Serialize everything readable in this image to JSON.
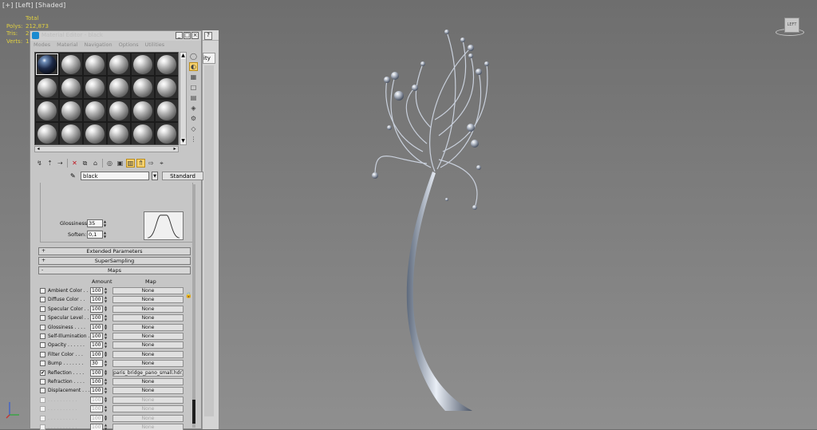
{
  "viewport": {
    "label": "[+] [Left] [Shaded]",
    "stats": [
      {
        "key": "",
        "value": "Total"
      },
      {
        "key": "Polys:",
        "value": "212,873"
      },
      {
        "key": "Tris:",
        "value": "2"
      },
      {
        "key": "Verts:",
        "value": "1"
      }
    ],
    "viewcube_label": "LEFT"
  },
  "back_window": {
    "tab_label": "ity",
    "button": "?"
  },
  "material_editor": {
    "title": "Material Editor - black",
    "window_buttons": {
      "minimize": "_",
      "maximize": "□",
      "close": "×"
    },
    "menu": [
      "Modes",
      "Material",
      "Navigation",
      "Options",
      "Utilities"
    ],
    "material_name": "black",
    "material_type": "Standard",
    "shader": {
      "glossiness_label": "Glossiness:",
      "glossiness": "35",
      "soften_label": "Soften:",
      "soften": "0,1"
    },
    "rollouts": {
      "extended": {
        "sign": "+",
        "label": "Extended Parameters"
      },
      "supersampling": {
        "sign": "+",
        "label": "SuperSampling"
      },
      "maps": {
        "sign": "-",
        "label": "Maps"
      }
    },
    "maps_header": {
      "amount": "Amount",
      "map": "Map"
    },
    "maps": [
      {
        "label": "Ambient Color . .",
        "amount": "100",
        "map": "None",
        "checked": false,
        "enabled": true
      },
      {
        "label": "Diffuse Color . .",
        "amount": "100",
        "map": "None",
        "checked": false,
        "enabled": true
      },
      {
        "label": "Specular Color . .",
        "amount": "100",
        "map": "None",
        "checked": false,
        "enabled": true
      },
      {
        "label": "Specular Level . .",
        "amount": "100",
        "map": "None",
        "checked": false,
        "enabled": true
      },
      {
        "label": "Glossiness . . . .",
        "amount": "100",
        "map": "None",
        "checked": false,
        "enabled": true
      },
      {
        "label": "Self-Illumination .",
        "amount": "100",
        "map": "None",
        "checked": false,
        "enabled": true
      },
      {
        "label": "Opacity . . . . . .",
        "amount": "100",
        "map": "None",
        "checked": false,
        "enabled": true
      },
      {
        "label": "Filter Color . . .",
        "amount": "100",
        "map": "None",
        "checked": false,
        "enabled": true
      },
      {
        "label": "Bump . . . . . . .",
        "amount": "30",
        "map": "None",
        "checked": false,
        "enabled": true
      },
      {
        "label": "Reflection . . . .",
        "amount": "100",
        "map": "paris_bridge_pano_small.hdr)",
        "checked": true,
        "enabled": true
      },
      {
        "label": "Refraction . . . .",
        "amount": "100",
        "map": "None",
        "checked": false,
        "enabled": true
      },
      {
        "label": "Displacement . . .",
        "amount": "100",
        "map": "None",
        "checked": false,
        "enabled": true
      },
      {
        "label": ". . . . . . . . . .",
        "amount": "100",
        "map": "None",
        "checked": false,
        "enabled": false
      },
      {
        "label": ". . . . . . . . . .",
        "amount": "100",
        "map": "None",
        "checked": false,
        "enabled": false
      },
      {
        "label": ". . . . . . . . . .",
        "amount": "100",
        "map": "None",
        "checked": false,
        "enabled": false
      },
      {
        "label": ". . . . . . . . . .",
        "amount": "100",
        "map": "None",
        "checked": false,
        "enabled": false
      },
      {
        "label": ". . . . . . . . . .",
        "amount": "100",
        "map": "None",
        "checked": false,
        "enabled": false
      }
    ],
    "icons": {
      "side_tools": [
        "sample-type-sphere-icon",
        "backlight-icon",
        "checker-background-icon",
        "uv-tiling-icon",
        "video-check-icon",
        "make-preview-icon",
        "options-icon",
        "select-by-material-icon",
        "material-navigator-icon"
      ],
      "toolbar": [
        "get-material-icon",
        "put-to-scene-icon",
        "assign-to-selection-icon",
        "delete-icon",
        "make-unique-icon",
        "put-to-library-icon",
        "material-effects-channel-icon",
        "show-shaded-material-icon",
        "show-end-result-icon",
        "go-to-parent-icon",
        "go-forward-to-sibling-icon",
        "pick-from-object-icon"
      ]
    }
  },
  "colors": {
    "viewport_top": "#6e6e6e",
    "viewport_bottom": "#8f8f8f",
    "stats_text": "#e0d040",
    "panel_bg": "#c6c6c6",
    "highlight_tool": "#f6d16b"
  }
}
